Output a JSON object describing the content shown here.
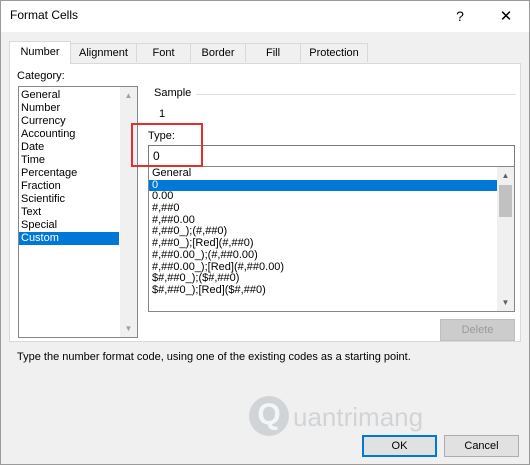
{
  "window": {
    "title": "Format Cells",
    "help_glyph": "?",
    "close_glyph": "✕"
  },
  "tabs": [
    "Number",
    "Alignment",
    "Font",
    "Border",
    "Fill",
    "Protection"
  ],
  "active_tab": "Number",
  "category": {
    "label": "Category:",
    "items": [
      "General",
      "Number",
      "Currency",
      "Accounting",
      "Date",
      "Time",
      "Percentage",
      "Fraction",
      "Scientific",
      "Text",
      "Special",
      "Custom"
    ],
    "selected": "Custom"
  },
  "sample": {
    "label": "Sample",
    "value": "1"
  },
  "type": {
    "label": "Type:",
    "value": "0"
  },
  "format_list": {
    "items": [
      "General",
      "0",
      "0.00",
      "#,##0",
      "#,##0.00",
      "#,##0_);(#,##0)",
      "#,##0_);[Red](#,##0)",
      "#,##0.00_);(#,##0.00)",
      "#,##0.00_);[Red](#,##0.00)",
      "$#,##0_);($#,##0)",
      "$#,##0_);[Red]($#,##0)"
    ],
    "selected": "0"
  },
  "buttons": {
    "delete": "Delete",
    "ok": "OK",
    "cancel": "Cancel"
  },
  "hint_text": "Type the number format code, using one of the existing codes as a starting point.",
  "watermark": {
    "glyph": "Q",
    "text": "uantrimang"
  },
  "colors": {
    "accent": "#0078d7",
    "highlight_box": "#e03030"
  }
}
